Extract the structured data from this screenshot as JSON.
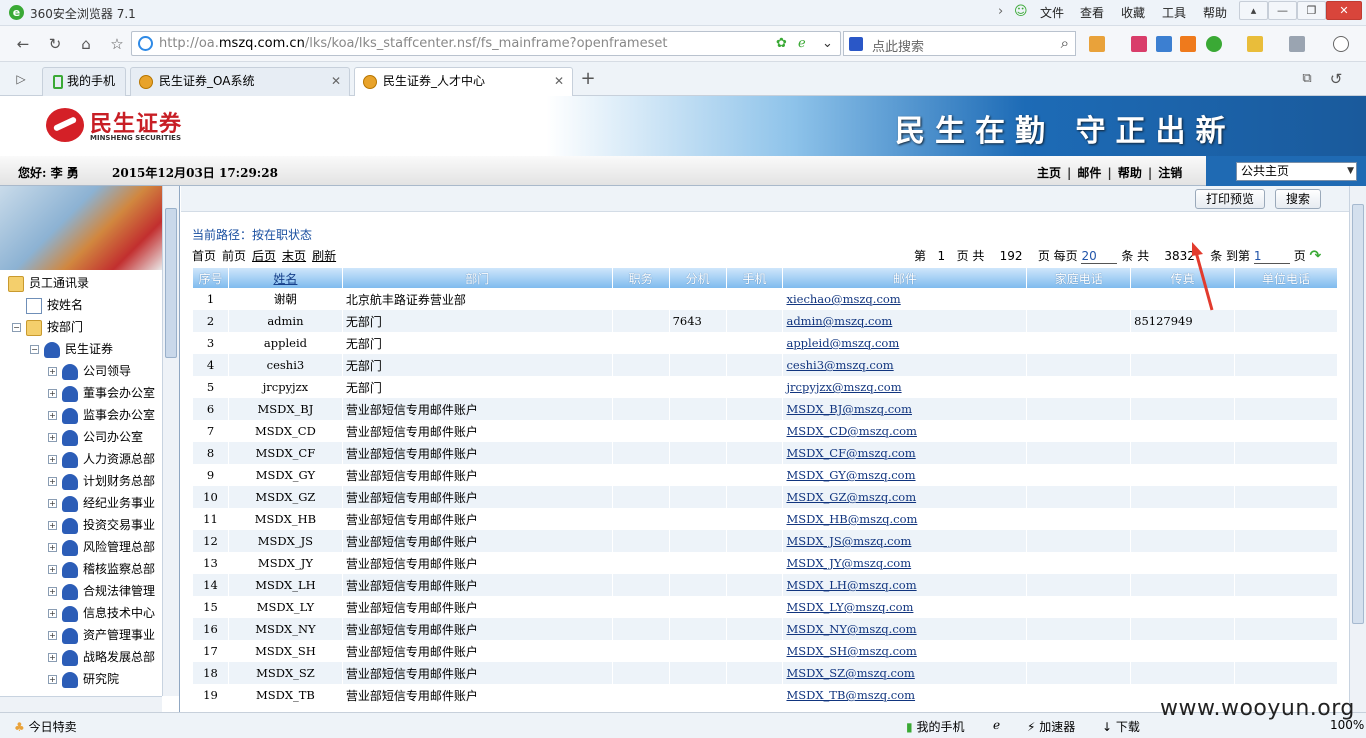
{
  "browser": {
    "title": "360安全浏览器 7.1",
    "menu": [
      "文件",
      "查看",
      "收藏",
      "工具",
      "帮助"
    ],
    "url_prefix": "http://oa.",
    "url_domain": "mszq.com.cn",
    "url_path": "/lks/koa/lks_staffcenter.nsf/fs_mainframe?openframeset",
    "search_placeholder": "点此搜索",
    "tabs": [
      {
        "label": "我的手机"
      },
      {
        "label": "民生证券_OA系统"
      },
      {
        "label": "民生证券_人才中心"
      }
    ],
    "status": {
      "left": "今日特卖",
      "phone": "我的手机",
      "accel": "加速器",
      "download": "下载",
      "zoom": "100%"
    }
  },
  "header": {
    "logo_cn": "民生证券",
    "logo_en": "MINSHENG SECURITIES",
    "slogan": "民生在勤 守正出新"
  },
  "userbar": {
    "greeting": "您好: 李 勇",
    "datetime": "2015年12月03日 17:29:28",
    "links": [
      "主页",
      "邮件",
      "帮助",
      "注销"
    ],
    "portal_select": "公共主页"
  },
  "sidebar": {
    "root": "员工通讯录",
    "by_name": "按姓名",
    "by_dept": "按部门",
    "company": "民生证券",
    "departments": [
      "公司领导",
      "董事会办公室",
      "监事会办公室",
      "公司办公室",
      "人力资源总部",
      "计划财务总部",
      "经纪业务事业",
      "投资交易事业",
      "风险管理总部",
      "稽核监察总部",
      "合规法律管理",
      "信息技术中心",
      "资产管理事业",
      "战略发展总部",
      "研究院"
    ]
  },
  "toolbar": {
    "print_preview": "打印预览",
    "search": "搜索"
  },
  "main": {
    "breadcrumb": "当前路径：按在职状态",
    "pager": {
      "first": "首页",
      "prev": "前页",
      "next": "后页",
      "last": "末页",
      "refresh": "刷新"
    },
    "page_info": {
      "p1": "第",
      "current_page": "1",
      "p2": "页 共",
      "total_pages": "192",
      "p3": "页 每页",
      "per_page": "20",
      "p4": "条 共",
      "total_records": "3832",
      "p5": "条 到第",
      "goto_page": "1",
      "p6": "页"
    },
    "columns": [
      "序号",
      "姓名",
      "部门",
      "职务",
      "分机",
      "手机",
      "邮件",
      "家庭电话",
      "传真",
      "单位电话"
    ],
    "rows": [
      {
        "no": "1",
        "name": "谢朝",
        "dept": "北京航丰路证券营业部",
        "ext": "",
        "email": "xiechao@mszq.com",
        "fax": ""
      },
      {
        "no": "2",
        "name": "admin",
        "dept": "无部门",
        "ext": "7643",
        "email": "admin@mszq.com",
        "fax": "85127949"
      },
      {
        "no": "3",
        "name": "appleid",
        "dept": "无部门",
        "ext": "",
        "email": "appleid@mszq.com",
        "fax": ""
      },
      {
        "no": "4",
        "name": "ceshi3",
        "dept": "无部门",
        "ext": "",
        "email": "ceshi3@mszq.com",
        "fax": ""
      },
      {
        "no": "5",
        "name": "jrcpyjzx",
        "dept": "无部门",
        "ext": "",
        "email": "jrcpyjzx@mszq.com",
        "fax": ""
      },
      {
        "no": "6",
        "name": "MSDX_BJ",
        "dept": "营业部短信专用邮件账户",
        "ext": "",
        "email": "MSDX_BJ@mszq.com",
        "fax": ""
      },
      {
        "no": "7",
        "name": "MSDX_CD",
        "dept": "营业部短信专用邮件账户",
        "ext": "",
        "email": "MSDX_CD@mszq.com",
        "fax": ""
      },
      {
        "no": "8",
        "name": "MSDX_CF",
        "dept": "营业部短信专用邮件账户",
        "ext": "",
        "email": "MSDX_CF@mszq.com",
        "fax": ""
      },
      {
        "no": "9",
        "name": "MSDX_GY",
        "dept": "营业部短信专用邮件账户",
        "ext": "",
        "email": "MSDX_GY@mszq.com",
        "fax": ""
      },
      {
        "no": "10",
        "name": "MSDX_GZ",
        "dept": "营业部短信专用邮件账户",
        "ext": "",
        "email": "MSDX_GZ@mszq.com",
        "fax": ""
      },
      {
        "no": "11",
        "name": "MSDX_HB",
        "dept": "营业部短信专用邮件账户",
        "ext": "",
        "email": "MSDX_HB@mszq.com",
        "fax": ""
      },
      {
        "no": "12",
        "name": "MSDX_JS",
        "dept": "营业部短信专用邮件账户",
        "ext": "",
        "email": "MSDX_JS@mszq.com",
        "fax": ""
      },
      {
        "no": "13",
        "name": "MSDX_JY",
        "dept": "营业部短信专用邮件账户",
        "ext": "",
        "email": "MSDX_JY@mszq.com",
        "fax": ""
      },
      {
        "no": "14",
        "name": "MSDX_LH",
        "dept": "营业部短信专用邮件账户",
        "ext": "",
        "email": "MSDX_LH@mszq.com",
        "fax": ""
      },
      {
        "no": "15",
        "name": "MSDX_LY",
        "dept": "营业部短信专用邮件账户",
        "ext": "",
        "email": "MSDX_LY@mszq.com",
        "fax": ""
      },
      {
        "no": "16",
        "name": "MSDX_NY",
        "dept": "营业部短信专用邮件账户",
        "ext": "",
        "email": "MSDX_NY@mszq.com",
        "fax": ""
      },
      {
        "no": "17",
        "name": "MSDX_SH",
        "dept": "营业部短信专用邮件账户",
        "ext": "",
        "email": "MSDX_SH@mszq.com",
        "fax": ""
      },
      {
        "no": "18",
        "name": "MSDX_SZ",
        "dept": "营业部短信专用邮件账户",
        "ext": "",
        "email": "MSDX_SZ@mszq.com",
        "fax": ""
      },
      {
        "no": "19",
        "name": "MSDX_TB",
        "dept": "营业部短信专用邮件账户",
        "ext": "",
        "email": "MSDX_TB@mszq.com",
        "fax": ""
      }
    ]
  },
  "watermark": "www.wooyun.org",
  "colors": {
    "header_blue": "#1f6ab3",
    "grid_header": "#7fbbee",
    "logo_red": "#d42027"
  }
}
